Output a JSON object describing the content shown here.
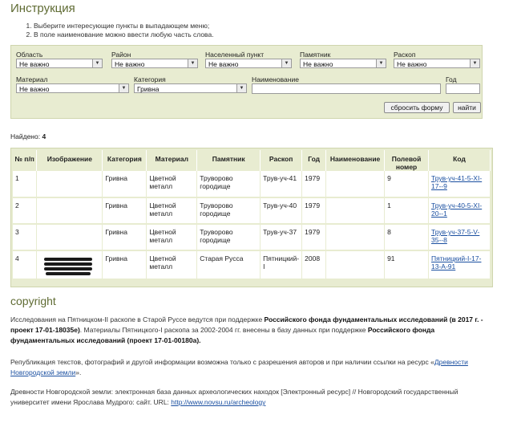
{
  "page_title": "Инструкция",
  "instructions": [
    "Выберите интересующие пункты в выпадающем меню;",
    "В поле наименование можно ввести любую часть слова."
  ],
  "filters": {
    "oblast": {
      "label": "Область",
      "value": "Не важно"
    },
    "rayon": {
      "label": "Район",
      "value": "Не важно"
    },
    "punkt": {
      "label": "Населенный пункт",
      "value": "Не важно"
    },
    "pamyatnik": {
      "label": "Памятник",
      "value": "Не важно"
    },
    "raskop": {
      "label": "Раскоп",
      "value": "Не важно"
    },
    "material": {
      "label": "Материал",
      "value": "Не важно"
    },
    "kategoriya": {
      "label": "Категория",
      "value": "Гривна"
    },
    "naimenovanie": {
      "label": "Наименование",
      "value": ""
    },
    "god": {
      "label": "Год",
      "value": ""
    },
    "reset_label": "сбросить форму",
    "search_label": "найти"
  },
  "found": {
    "label": "Найдено:",
    "count": "4"
  },
  "table": {
    "headers": [
      "№ п/п",
      "Изображение",
      "Категория",
      "Материал",
      "Памятник",
      "Раскоп",
      "Год",
      "Наименование",
      "Полевой номер",
      "Код"
    ],
    "rows": [
      {
        "num": "1",
        "cat": "Гривна",
        "mat": "Цветной металл",
        "pam": "Труворово городище",
        "raskop": "Трув-уч-41",
        "god": "1979",
        "naim": "",
        "pole": "9",
        "kod": "Трув-уч-41-5-XI-17--9"
      },
      {
        "num": "2",
        "cat": "Гривна",
        "mat": "Цветной металл",
        "pam": "Труворово городище",
        "raskop": "Трув-уч-40",
        "god": "1979",
        "naim": "",
        "pole": "1",
        "kod": "Трув-уч-40-5-XI-20--1"
      },
      {
        "num": "3",
        "cat": "Гривна",
        "mat": "Цветной металл",
        "pam": "Труворово городище",
        "raskop": "Трув-уч-37",
        "god": "1979",
        "naim": "",
        "pole": "8",
        "kod": "Трув-уч-37-5-V-35--8"
      },
      {
        "num": "4",
        "cat": "Гривна",
        "mat": "Цветной металл",
        "pam": "Старая Русса",
        "raskop": "Пятницкий-I",
        "god": "2008",
        "naim": "",
        "pole": "91",
        "kod": "Пятницкий-I-17-13-А-91"
      }
    ]
  },
  "copyright": {
    "heading": "copyright",
    "p1_a": "Исследования на Пятницком-II раскопе в Старой Руссе ведутся при поддержке ",
    "p1_b": "Российского фонда фундаментальных исследований (в 2017 г. - проект 17-01-18035е)",
    "p1_c": ". Материалы Пятницкого-I раскопа за 2002-2004 гг. внесены в базу данных при поддержке ",
    "p1_d": "Российского фонда фундаментальных исследований (проект 17-01-00180а).",
    "p2_a": "Републикация текстов, фотографий и другой информации возможна только с разрешения авторов и при наличии ссылки на ресурс «",
    "p2_link": "Древности Новгородской земли",
    "p2_b": "».",
    "p3_a": "Древности Новгородской земли: электронная база данных археологических находок [Электронный ресурс] // Новгородский государственный университет имени Ярослава Мудрого: сайт. URL: ",
    "p3_link": "http://www.novsu.ru/archeology"
  }
}
